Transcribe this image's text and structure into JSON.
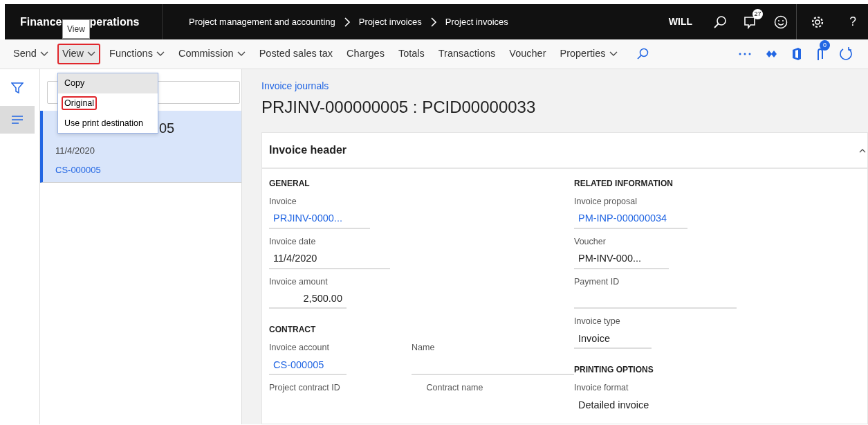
{
  "top_bar": {
    "brand": [
      "Finance",
      "perations"
    ],
    "tooltip": "View",
    "breadcrumbs": [
      "Project management and accounting",
      "Project invoices",
      "Project invoices"
    ],
    "user": "WILL",
    "notification_count": "27",
    "help": "?"
  },
  "action_bar": {
    "items": [
      {
        "label": "Send",
        "dropdown": true,
        "highlighted": false
      },
      {
        "label": "View",
        "dropdown": true,
        "highlighted": true
      },
      {
        "label": "Functions",
        "dropdown": true,
        "highlighted": false
      },
      {
        "label": "Commission",
        "dropdown": true,
        "highlighted": false
      },
      {
        "label": "Posted sales tax",
        "dropdown": false,
        "highlighted": false
      },
      {
        "label": "Charges",
        "dropdown": false,
        "highlighted": false
      },
      {
        "label": "Totals",
        "dropdown": false,
        "highlighted": false
      },
      {
        "label": "Transactions",
        "dropdown": false,
        "highlighted": false
      },
      {
        "label": "Voucher",
        "dropdown": false,
        "highlighted": false
      },
      {
        "label": "Properties",
        "dropdown": true,
        "highlighted": false
      }
    ],
    "attachment_count": "0"
  },
  "menu": {
    "items": [
      {
        "label": "Copy",
        "selected": true,
        "highlighted": false
      },
      {
        "label": "Original",
        "selected": false,
        "highlighted": true
      },
      {
        "label": "Use print destination",
        "selected": false,
        "highlighted": false
      }
    ]
  },
  "side_rail": {
    "items": [
      {
        "kind": "filter",
        "selected": false
      },
      {
        "kind": "list",
        "selected": true
      }
    ]
  },
  "list": {
    "items": [
      {
        "title": "05",
        "date": "11/4/2020",
        "account": "CS-000005",
        "selected": true
      }
    ]
  },
  "page": {
    "breadcrumb": "Invoice journals",
    "title": "PRJINV-000000005 : PCID00000033"
  },
  "fasttab": {
    "title": "Invoice header",
    "expanded": true,
    "columns": [
      [
        {
          "heading": "GENERAL",
          "rows": [
            [
              {
                "label": "Invoice",
                "value": "PRJINV-0000...",
                "kind": "link"
              }
            ],
            [
              {
                "label": "Invoice date",
                "value": "11/4/2020",
                "kind": "text"
              }
            ],
            [
              {
                "label": "Invoice amount",
                "value": "2,500.00",
                "kind": "number"
              }
            ]
          ]
        },
        {
          "heading": "CONTRACT",
          "rows": [
            [
              {
                "label": "Invoice account",
                "value": "CS-000005",
                "kind": "link"
              },
              {
                "label": "Name",
                "kind": "empty"
              }
            ],
            [
              {
                "label": "Project contract ID",
                "kind": "label"
              },
              {
                "label": "Contract name",
                "kind": "label"
              }
            ]
          ]
        }
      ],
      [
        {
          "heading": "RELATED INFORMATION",
          "rows": [
            [
              {
                "label": "Invoice proposal",
                "value": "PM-INP-000000034",
                "kind": "link"
              }
            ],
            [
              {
                "label": "Voucher",
                "value": "PM-INV-000...",
                "kind": "text"
              }
            ],
            [
              {
                "label": "Payment ID",
                "kind": "empty"
              }
            ],
            [
              {
                "label": "Invoice type",
                "value": "Invoice",
                "kind": "text"
              }
            ]
          ]
        },
        {
          "heading": "PRINTING OPTIONS",
          "rows": [
            [
              {
                "label": "Invoice format",
                "value": "Detailed invoice",
                "kind": "open"
              }
            ]
          ]
        }
      ]
    ]
  }
}
